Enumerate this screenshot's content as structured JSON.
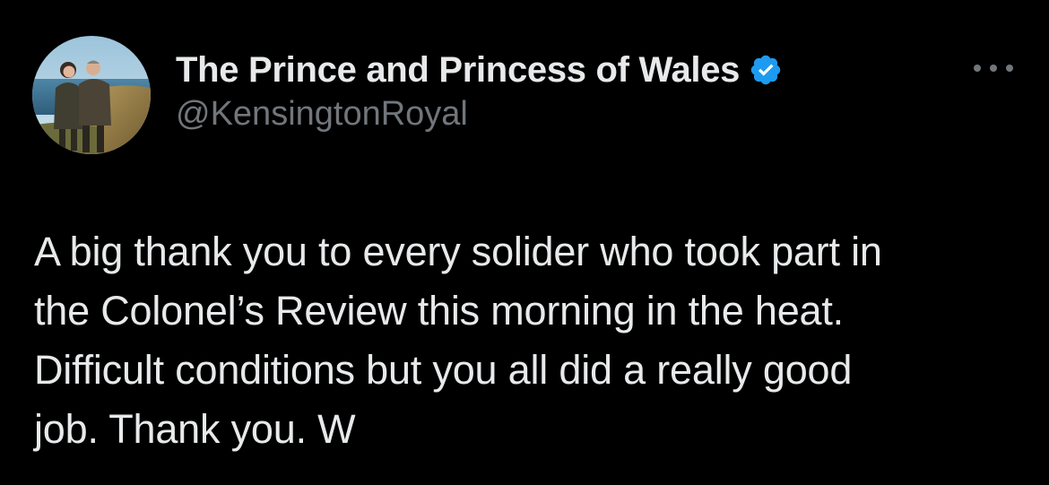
{
  "tweet": {
    "display_name": "The Prince and Princess of Wales",
    "handle": "@KensingtonRoyal",
    "verified": true,
    "text_lines": [
      "A big thank you to every solider who took part in",
      "the Colonel’s Review this morning in the heat.",
      "Difficult conditions but you all did a really good",
      "job. Thank you. W"
    ]
  },
  "icons": {
    "verified": "verified-badge-icon",
    "more": "more-options-icon"
  },
  "colors": {
    "background": "#000000",
    "primary_text": "#e7e9ea",
    "secondary_text": "#71767b",
    "verified_blue": "#1d9bf0"
  }
}
